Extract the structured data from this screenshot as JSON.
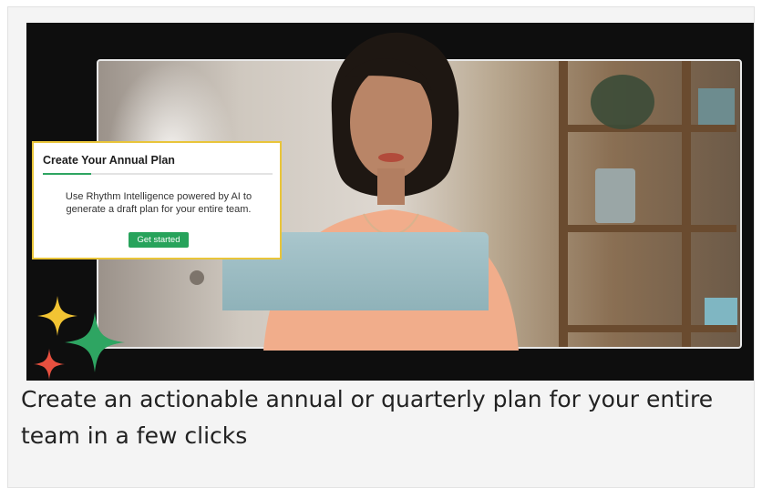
{
  "hero": {
    "plan_card": {
      "title": "Create Your Annual Plan",
      "progress_fraction": 0.21,
      "description": "Use Rhythm Intelligence powered by AI to generate a draft plan for your entire team.",
      "button_label": "Get started",
      "accent_color": "#27a35b",
      "border_color": "#e9c53a"
    },
    "sparkles": [
      {
        "name": "yellow-sparkle-icon",
        "color": "#f2c433"
      },
      {
        "name": "green-sparkle-icon",
        "color": "#2ea562"
      },
      {
        "name": "red-sparkle-icon",
        "color": "#e8503f"
      }
    ]
  },
  "caption": "Create an actionable annual or quarterly plan for your entire team in a few clicks"
}
